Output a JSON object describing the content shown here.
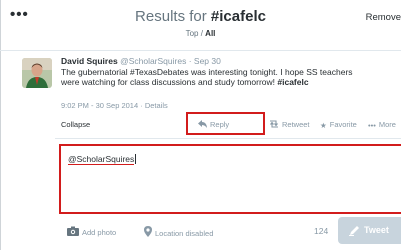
{
  "header": {
    "menu_icon": "more-dots-icon",
    "title_prefix": "Results for ",
    "title_query": "#icafelc",
    "filter_top": "Top",
    "filter_sep": " / ",
    "filter_all": "All",
    "remove_label": "Remove"
  },
  "tweet": {
    "author_name": "David Squires",
    "author_handle": "@ScholarSquires",
    "date_sep": " · ",
    "date": "Sep 30",
    "text_line1": "The gubernatorial #TexasDebates was interesting tonight. I hope SS teachers",
    "text_line2_prefix": "were watching for class discussions and study tomorrow! ",
    "text_line2_tag": "#icafelc",
    "timestamp": "9:02 PM - 30 Sep 2014",
    "details_sep": " · ",
    "details_label": "Details",
    "collapse_label": "Collapse"
  },
  "actions": {
    "reply_label": "Reply",
    "retweet_label": "Retweet",
    "favorite_label": "Favorite",
    "more_label": "More",
    "highlight_color": "#d21c1c"
  },
  "composer": {
    "value": "@ScholarSquires",
    "add_photo_label": "Add photo",
    "location_label": "Location disabled",
    "char_count": "124",
    "tweet_button_label": "Tweet"
  }
}
